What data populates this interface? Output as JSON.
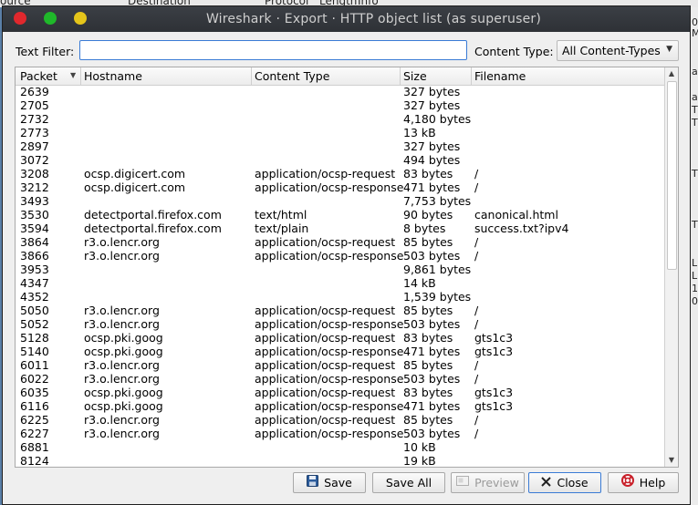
{
  "window": {
    "title": "Wireshark · Export · HTTP object list (as superuser)"
  },
  "background_window": {
    "header_fragments": [
      "ource",
      "Destination",
      "Protocol",
      "Length",
      "Info"
    ],
    "right_fragments": [
      "0",
      "M",
      "a",
      "a",
      "T",
      "T",
      "T",
      "T",
      "L",
      "L",
      "1",
      "0"
    ]
  },
  "filter": {
    "label": "Text Filter:",
    "value": "",
    "placeholder": ""
  },
  "content_type": {
    "label": "Content Type:",
    "selected": "All Content-Types"
  },
  "table": {
    "columns": [
      "Packet",
      "Hostname",
      "Content Type",
      "Size",
      "Filename"
    ],
    "rows": [
      {
        "packet": "2639",
        "host": "",
        "type": "",
        "size": "327 bytes",
        "file": ""
      },
      {
        "packet": "2705",
        "host": "",
        "type": "",
        "size": "327 bytes",
        "file": ""
      },
      {
        "packet": "2732",
        "host": "",
        "type": "",
        "size": "4,180 bytes",
        "file": ""
      },
      {
        "packet": "2773",
        "host": "",
        "type": "",
        "size": "13 kB",
        "file": ""
      },
      {
        "packet": "2897",
        "host": "",
        "type": "",
        "size": "327 bytes",
        "file": ""
      },
      {
        "packet": "3072",
        "host": "",
        "type": "",
        "size": "494 bytes",
        "file": ""
      },
      {
        "packet": "3208",
        "host": "ocsp.digicert.com",
        "type": "application/ocsp-request",
        "size": "83 bytes",
        "file": "/"
      },
      {
        "packet": "3212",
        "host": "ocsp.digicert.com",
        "type": "application/ocsp-response",
        "size": "471 bytes",
        "file": "/"
      },
      {
        "packet": "3493",
        "host": "",
        "type": "",
        "size": "7,753 bytes",
        "file": ""
      },
      {
        "packet": "3530",
        "host": "detectportal.firefox.com",
        "type": "text/html",
        "size": "90 bytes",
        "file": "canonical.html"
      },
      {
        "packet": "3594",
        "host": "detectportal.firefox.com",
        "type": "text/plain",
        "size": "8 bytes",
        "file": "success.txt?ipv4"
      },
      {
        "packet": "3864",
        "host": "r3.o.lencr.org",
        "type": "application/ocsp-request",
        "size": "85 bytes",
        "file": "/"
      },
      {
        "packet": "3866",
        "host": "r3.o.lencr.org",
        "type": "application/ocsp-response",
        "size": "503 bytes",
        "file": "/"
      },
      {
        "packet": "3953",
        "host": "",
        "type": "",
        "size": "9,861 bytes",
        "file": ""
      },
      {
        "packet": "4347",
        "host": "",
        "type": "",
        "size": "14 kB",
        "file": ""
      },
      {
        "packet": "4352",
        "host": "",
        "type": "",
        "size": "1,539 bytes",
        "file": ""
      },
      {
        "packet": "5050",
        "host": "r3.o.lencr.org",
        "type": "application/ocsp-request",
        "size": "85 bytes",
        "file": "/"
      },
      {
        "packet": "5052",
        "host": "r3.o.lencr.org",
        "type": "application/ocsp-response",
        "size": "503 bytes",
        "file": "/"
      },
      {
        "packet": "5128",
        "host": "ocsp.pki.goog",
        "type": "application/ocsp-request",
        "size": "83 bytes",
        "file": "gts1c3"
      },
      {
        "packet": "5140",
        "host": "ocsp.pki.goog",
        "type": "application/ocsp-response",
        "size": "471 bytes",
        "file": "gts1c3"
      },
      {
        "packet": "6011",
        "host": "r3.o.lencr.org",
        "type": "application/ocsp-request",
        "size": "85 bytes",
        "file": "/"
      },
      {
        "packet": "6022",
        "host": "r3.o.lencr.org",
        "type": "application/ocsp-response",
        "size": "503 bytes",
        "file": "/"
      },
      {
        "packet": "6035",
        "host": "ocsp.pki.goog",
        "type": "application/ocsp-request",
        "size": "83 bytes",
        "file": "gts1c3"
      },
      {
        "packet": "6116",
        "host": "ocsp.pki.goog",
        "type": "application/ocsp-response",
        "size": "471 bytes",
        "file": "gts1c3"
      },
      {
        "packet": "6225",
        "host": "r3.o.lencr.org",
        "type": "application/ocsp-request",
        "size": "85 bytes",
        "file": "/"
      },
      {
        "packet": "6227",
        "host": "r3.o.lencr.org",
        "type": "application/ocsp-response",
        "size": "503 bytes",
        "file": "/"
      },
      {
        "packet": "6881",
        "host": "",
        "type": "",
        "size": "10 kB",
        "file": ""
      },
      {
        "packet": "8124",
        "host": "",
        "type": "",
        "size": "19 kB",
        "file": ""
      }
    ]
  },
  "buttons": {
    "save": "Save",
    "save_all": "Save All",
    "preview": "Preview",
    "close": "Close",
    "help": "Help"
  },
  "icons": {
    "save": "floppy-disk-icon",
    "preview": "preview-document-icon",
    "close": "x-close-icon",
    "help": "lifebuoy-help-icon"
  },
  "colors": {
    "accent": "#3a7bd5",
    "titlebar": "#2e3136",
    "close_red": "#e0282d",
    "min_green": "#1fb82a",
    "max_yellow": "#e5c51a"
  }
}
